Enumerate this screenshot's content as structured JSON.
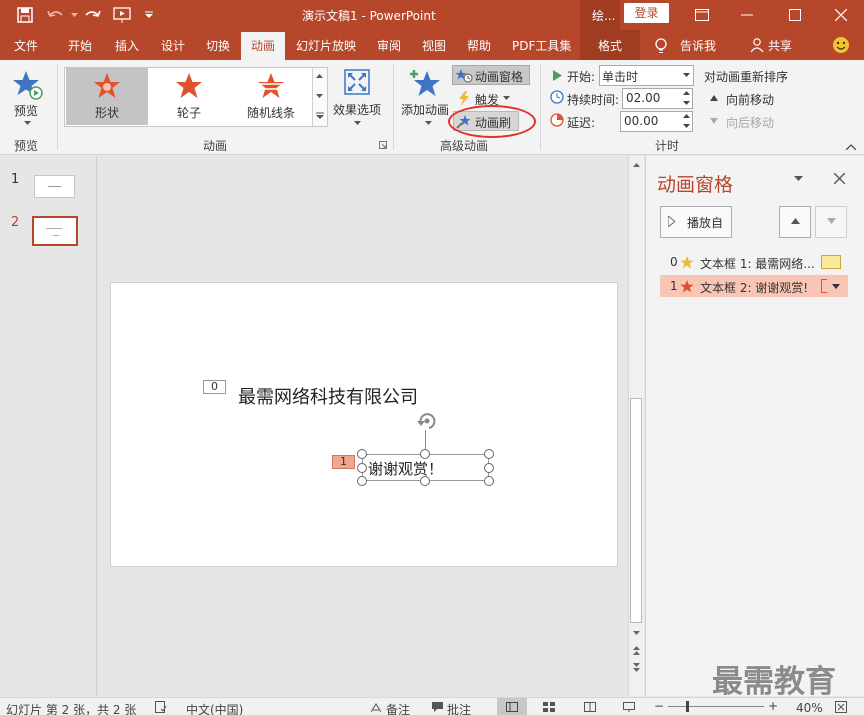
{
  "titlebar": {
    "doc_title": "演示文稿1 - PowerPoint",
    "draw_tab": "绘...",
    "login": "登录"
  },
  "menu": {
    "items": [
      "文件",
      "开始",
      "插入",
      "设计",
      "切换",
      "动画",
      "幻灯片放映",
      "审阅",
      "视图",
      "帮助",
      "PDF工具集",
      "格式"
    ],
    "tell": "告诉我",
    "share": "共享"
  },
  "ribbon": {
    "preview_label": "预览",
    "preview_group": "预览",
    "effects": [
      "形状",
      "轮子",
      "随机线条"
    ],
    "effect_options": "效果选项",
    "animation_group": "动画",
    "add_animation": "添加动画",
    "anim_pane": "动画窗格",
    "trigger": "触发",
    "anim_painter": "动画刷",
    "advanced_group": "高级动画",
    "start_label": "开始:",
    "start_value": "单击时",
    "duration_label": "持续时间:",
    "duration_value": "02.00",
    "delay_label": "延迟:",
    "delay_value": "00.00",
    "timing_group": "计时",
    "reorder_title": "对动画重新排序",
    "move_earlier": "向前移动",
    "move_later": "向后移动"
  },
  "thumbs": [
    {
      "num": "1"
    },
    {
      "num": "2"
    }
  ],
  "slide": {
    "title_text": "最需网络科技有限公司",
    "title_tag": "0",
    "thanks_text": "谢谢观赏！",
    "thanks_tag": "1"
  },
  "pane": {
    "title": "动画窗格",
    "play_label": "播放自",
    "items": [
      {
        "index": "0",
        "text": "文本框 1: 最需网络..."
      },
      {
        "index": "1",
        "text": "文本框 2: 谢谢观赏!"
      }
    ]
  },
  "status": {
    "slide_info": "幻灯片 第 2 张，共 2 张",
    "language": "中文(中国)",
    "notes": "备注",
    "comments": "批注",
    "zoom": "40%"
  },
  "watermark": "最需教育",
  "colors": {
    "accent": "#b7472a",
    "select_fill": "#f9c5b4",
    "star_gold": "#f0b93a",
    "star_orange": "#e0522d"
  }
}
